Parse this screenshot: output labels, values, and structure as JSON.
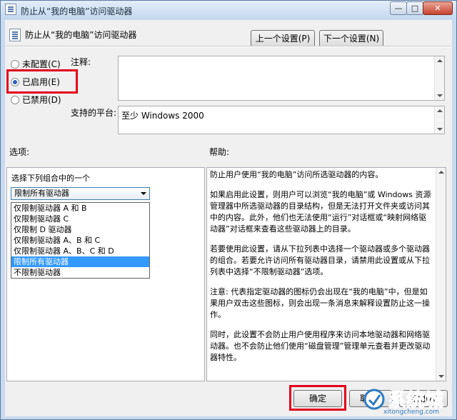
{
  "window": {
    "title": "防止从“我的电脑”访问驱动器",
    "min_glyph": "—",
    "max_glyph": "□",
    "close_glyph": "✕"
  },
  "header": {
    "title": "防止从“我的电脑”访问驱动器",
    "prev_label": "上一个设置(P)",
    "next_label": "下一个设置(N)"
  },
  "state": {
    "options": [
      {
        "label": "未配置(C)",
        "selected": false
      },
      {
        "label": "已启用(E)",
        "selected": true
      },
      {
        "label": "已禁用(D)",
        "selected": false
      }
    ]
  },
  "comment": {
    "label": "注释:",
    "value": ""
  },
  "platform": {
    "label": "支持的平台:",
    "value": "至少 Windows 2000"
  },
  "options_section": {
    "label": "选项:",
    "combo_caption": "选择下列组合中的一个",
    "selected_value": "限制所有驱动器",
    "items": [
      "仅限制驱动器 A 和 B",
      "仅限制驱动器 C",
      "仅限制 D 驱动器",
      "仅限制驱动器 A、B 和 C",
      "仅限制驱动器 A、B、C 和 D",
      "限制所有驱动器",
      "不限制驱动器"
    ],
    "selected_index": 5
  },
  "help_section": {
    "label": "帮助:",
    "paragraphs": [
      "防止用户使用“我的电脑”访问所选驱动器的内容。",
      "如果启用此设置，则用户可以浏览“我的电脑”或 Windows 资源管理器中所选驱动器的目录结构，但是无法打开文件夹或访问其中的内容。此外，他们也无法使用“运行”对话框或“映射网络驱动器”对话框来查看这些驱动器上的目录。",
      "若要使用此设置，请从下拉列表中选择一个驱动器或多个驱动器的组合。若要允许访问所有驱动器目录，请禁用此设置或从下拉列表中选择“不限制驱动器”选项。",
      "注意: 代表指定驱动器的图标仍会出现在“我的电脑”中，但是如果用户双击这些图标，则会出现一条消息来解释设置防止这一操作。",
      "同时，此设置不会防止用户使用程序来访问本地驱动器和网络驱动器。也不会防止他们使用“磁盘管理”管理单元查看并更改驱动器特性。"
    ]
  },
  "footer": {
    "ok_label": "确定",
    "cancel_label": "取",
    "apply_label": "应用(A)"
  },
  "watermark": {
    "brand": "系统城",
    "url": "xitongcheng.com"
  },
  "colors": {
    "highlight_border": "#e3001b",
    "selection": "#3399ff"
  }
}
